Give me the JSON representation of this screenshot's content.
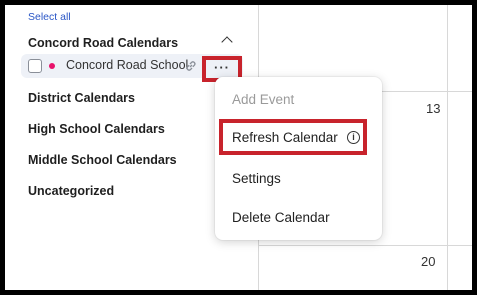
{
  "sidebar": {
    "select_all": "Select all",
    "groups": [
      {
        "label": "Concord Road Calendars"
      },
      {
        "label": "District Calendars"
      },
      {
        "label": "High School Calendars"
      },
      {
        "label": "Middle School Calendars"
      },
      {
        "label": "Uncategorized"
      }
    ],
    "calendar_item": {
      "name": "Concord Road School",
      "color": "#e8126b",
      "more_label": "···"
    }
  },
  "calendar_grid": {
    "day_numbers": [
      "13",
      "20"
    ]
  },
  "context_menu": {
    "items": [
      {
        "label": "Add Event",
        "disabled": true
      },
      {
        "label": "Refresh Calendar",
        "info_icon": "i"
      },
      {
        "label": "Settings"
      },
      {
        "label": "Delete Calendar"
      }
    ]
  },
  "colors": {
    "highlight": "#c8232c",
    "row_bg": "#eef1f7",
    "link": "#2a56c6"
  }
}
